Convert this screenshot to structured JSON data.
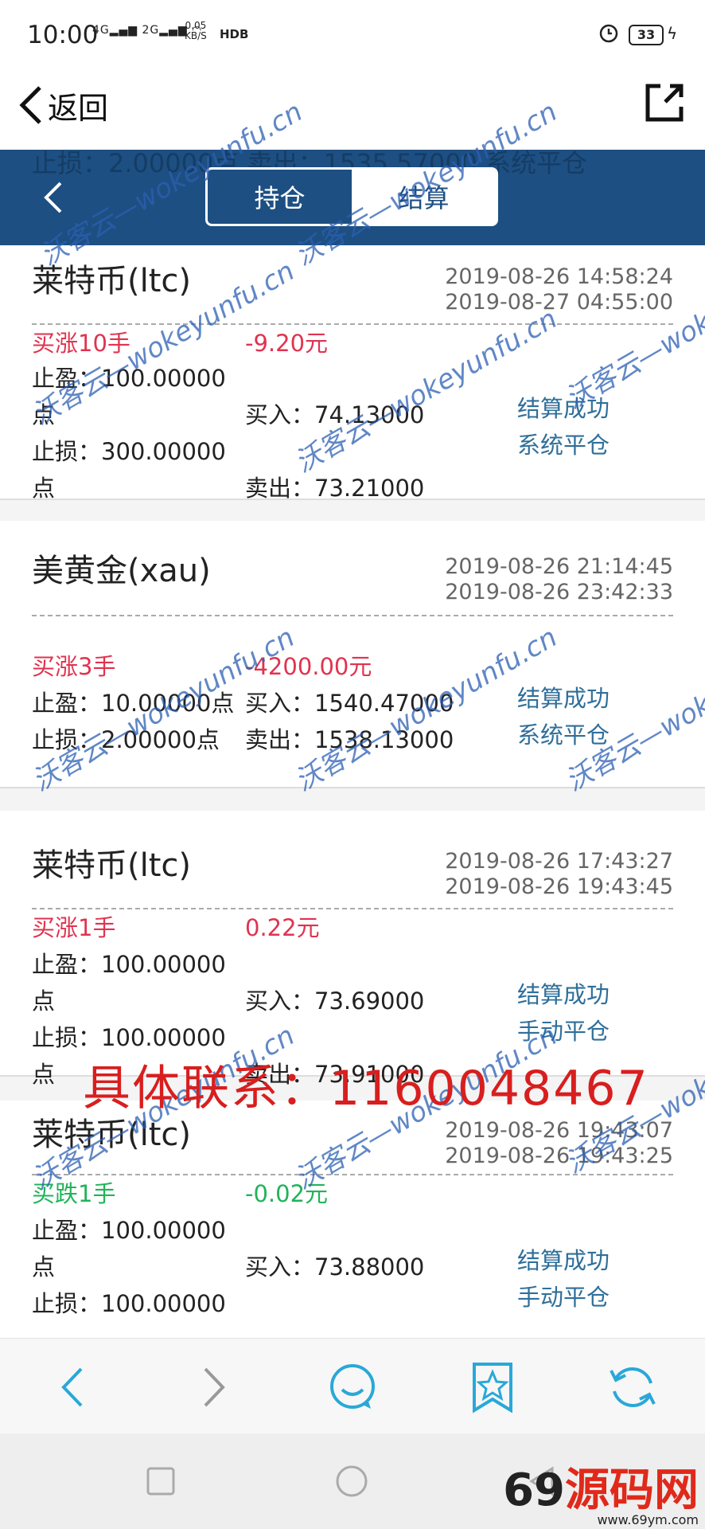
{
  "status_bar": {
    "time": "10:00",
    "signal_1": "4G",
    "signal_2": "2G",
    "speed_value": "0.05",
    "speed_unit": "KB/S",
    "hd": "HDB",
    "battery": "33"
  },
  "browser": {
    "back_label": "返回"
  },
  "header": {
    "ghost_text": "止损：2.00000点  卖出：1535.57000     系统平仓",
    "tabs": [
      {
        "label": "持仓",
        "active": true
      },
      {
        "label": "结算",
        "active": false
      }
    ]
  },
  "records": [
    {
      "name": "莱特币(ltc)",
      "open_time": "2019-08-26 14:58:24",
      "close_time": "2019-08-27 04:55:00",
      "direction": "买涨10手",
      "profit": "-9.20元",
      "take_profit": "止盈：100.00000",
      "take_profit_unit": "点",
      "stop_loss": "止损：300.00000",
      "stop_loss_unit": "点",
      "buy": "买入：74.13000",
      "sell": "卖出：73.21000",
      "status": "结算成功",
      "close_type": "系统平仓"
    },
    {
      "name": "美黄金(xau)",
      "open_time": "2019-08-26 21:14:45",
      "close_time": "2019-08-26 23:42:33",
      "direction": "买涨3手",
      "profit": "-4200.00元",
      "take_profit": "止盈：10.00000点",
      "stop_loss": "止损：2.00000点",
      "buy": "买入：1540.47000",
      "sell": "卖出：1538.13000",
      "status": "结算成功",
      "close_type": "系统平仓"
    },
    {
      "name": "莱特币(ltc)",
      "open_time": "2019-08-26 17:43:27",
      "close_time": "2019-08-26 19:43:45",
      "direction": "买涨1手",
      "profit": "0.22元",
      "take_profit": "止盈：100.00000",
      "take_profit_unit": "点",
      "stop_loss": "止损：100.00000",
      "stop_loss_unit": "点",
      "buy": "买入：73.69000",
      "sell": "卖出：73.91000",
      "status": "结算成功",
      "close_type": "手动平仓"
    },
    {
      "name": "莱特币(ltc)",
      "open_time": "2019-08-26 19:43:07",
      "close_time": "2019-08-26 19:43:25",
      "direction": "买跌1手",
      "profit": "-0.02元",
      "take_profit": "止盈：100.00000",
      "take_profit_unit": "点",
      "stop_loss": "止损：100.00000",
      "buy": "买入：73.88000",
      "status": "结算成功",
      "close_type": "手动平仓"
    }
  ],
  "overlay": {
    "contact": "具体联系：1160048467",
    "watermark": "沃客云—wokeyunfu.cn",
    "logo_main_a": "69",
    "logo_main_b": "源码网",
    "logo_sub": "www.69ym.com"
  },
  "colors": {
    "header_blue": "#1d4f82",
    "rise_red": "#e0334f",
    "fall_green": "#21b35a",
    "status_blue": "#2f6f9a",
    "toolbar_cyan": "#29a8d8"
  },
  "icons": [
    "back-chevron-icon",
    "share-icon",
    "forward-icon",
    "chat-icon",
    "bookmark-star-icon",
    "refresh-icon",
    "home-square-icon",
    "home-circle-icon",
    "back-triangle-icon"
  ]
}
